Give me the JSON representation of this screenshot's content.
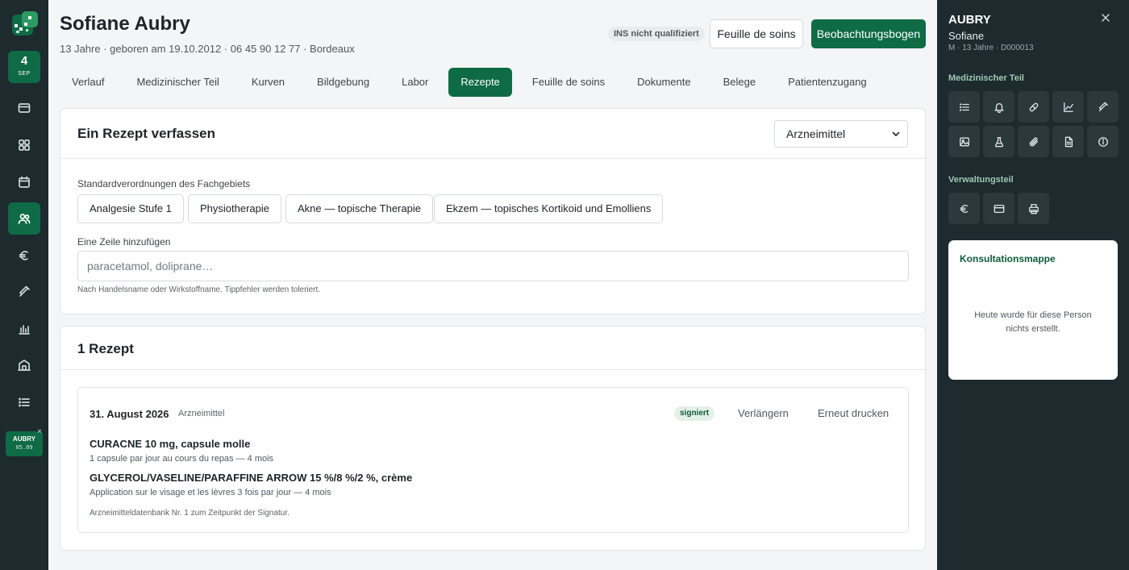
{
  "rail": {
    "date_day": "4",
    "date_month": "SEP",
    "items": [
      {
        "icon": "card-icon"
      },
      {
        "icon": "grid-icon"
      },
      {
        "icon": "calendar-icon"
      },
      {
        "icon": "users-icon",
        "active": true
      },
      {
        "icon": "euro-icon"
      },
      {
        "icon": "syringe-icon"
      },
      {
        "icon": "bar-chart-icon"
      },
      {
        "icon": "building-icon"
      },
      {
        "icon": "list-icon"
      }
    ],
    "patient_chip": {
      "name": "AUBRY",
      "time": "05.09",
      "close": "×"
    }
  },
  "header": {
    "name": "Sofiane Aubry",
    "subtitle": "13 Jahre · geboren am 19.10.2012 · 06 45 90 12 77 · Bordeaux",
    "ins_badge": "INS nicht qualifiziert",
    "btn_feuille": "Feuille de soins",
    "btn_beobachtung": "Beobachtungsbogen"
  },
  "tabs": [
    "Verlauf",
    "Medizinischer Teil",
    "Kurven",
    "Bildgebung",
    "Labor",
    "Rezepte",
    "Feuille de soins",
    "Dokumente",
    "Belege",
    "Patientenzugang"
  ],
  "active_tab": "Rezepte",
  "compose": {
    "title": "Ein Rezept verfassen",
    "type_select": "Arzneimittel",
    "standards_label": "Standardverordnungen des Fachgebiets",
    "standards": [
      "Analgesie Stufe 1",
      "Physiotherapie",
      "Akne — topische Therapie",
      "Ekzem — topisches Kortikoid und Emolliens"
    ],
    "add_line_label": "Eine Zeile hinzufügen",
    "search_placeholder": "paracetamol, doliprane…",
    "search_hint": "Nach Handelsname oder Wirkstoffname. Tippfehler werden toleriert."
  },
  "list": {
    "title": "1 Rezept",
    "prescription": {
      "date": "31. August 2026",
      "kind": "Arzneimittel",
      "status": "signiert",
      "extend": "Verlängern",
      "reprint": "Erneut drucken",
      "drugs": [
        {
          "name": "CURACNE 10 mg, capsule molle",
          "dosage": "1 capsule par jour au cours du repas — 4 mois"
        },
        {
          "name": "GLYCEROL/VASELINE/PARAFFINE ARROW 15 %/8 %/2 %, crème",
          "dosage": "Application sur le visage et les lèvres 3 fois par jour — 4 mois"
        }
      ],
      "footer": "Arzneimitteldatenbank Nr. 1 zum Zeitpunkt der Signatur."
    }
  },
  "side": {
    "lastname": "AUBRY",
    "firstname": "Sofiane",
    "meta": "M · 13 Jahre · D000013",
    "medical_label": "Medizinischer Teil",
    "medical_icons": [
      "list-icon",
      "bell-icon",
      "pill-icon",
      "line-chart-icon",
      "syringe-icon",
      "image-icon",
      "flask-icon",
      "paperclip-icon",
      "document-icon",
      "info-icon"
    ],
    "admin_label": "Verwaltungsteil",
    "admin_icons": [
      "euro-icon",
      "card-icon",
      "printer-icon"
    ],
    "folder_title": "Konsultationsmappe",
    "folder_empty": "Heute wurde für diese Person nichts erstellt."
  },
  "colors": {
    "brand": "#0e6b45",
    "sidebar": "#1d2a2e",
    "badge_bg": "#e3f1e8"
  }
}
